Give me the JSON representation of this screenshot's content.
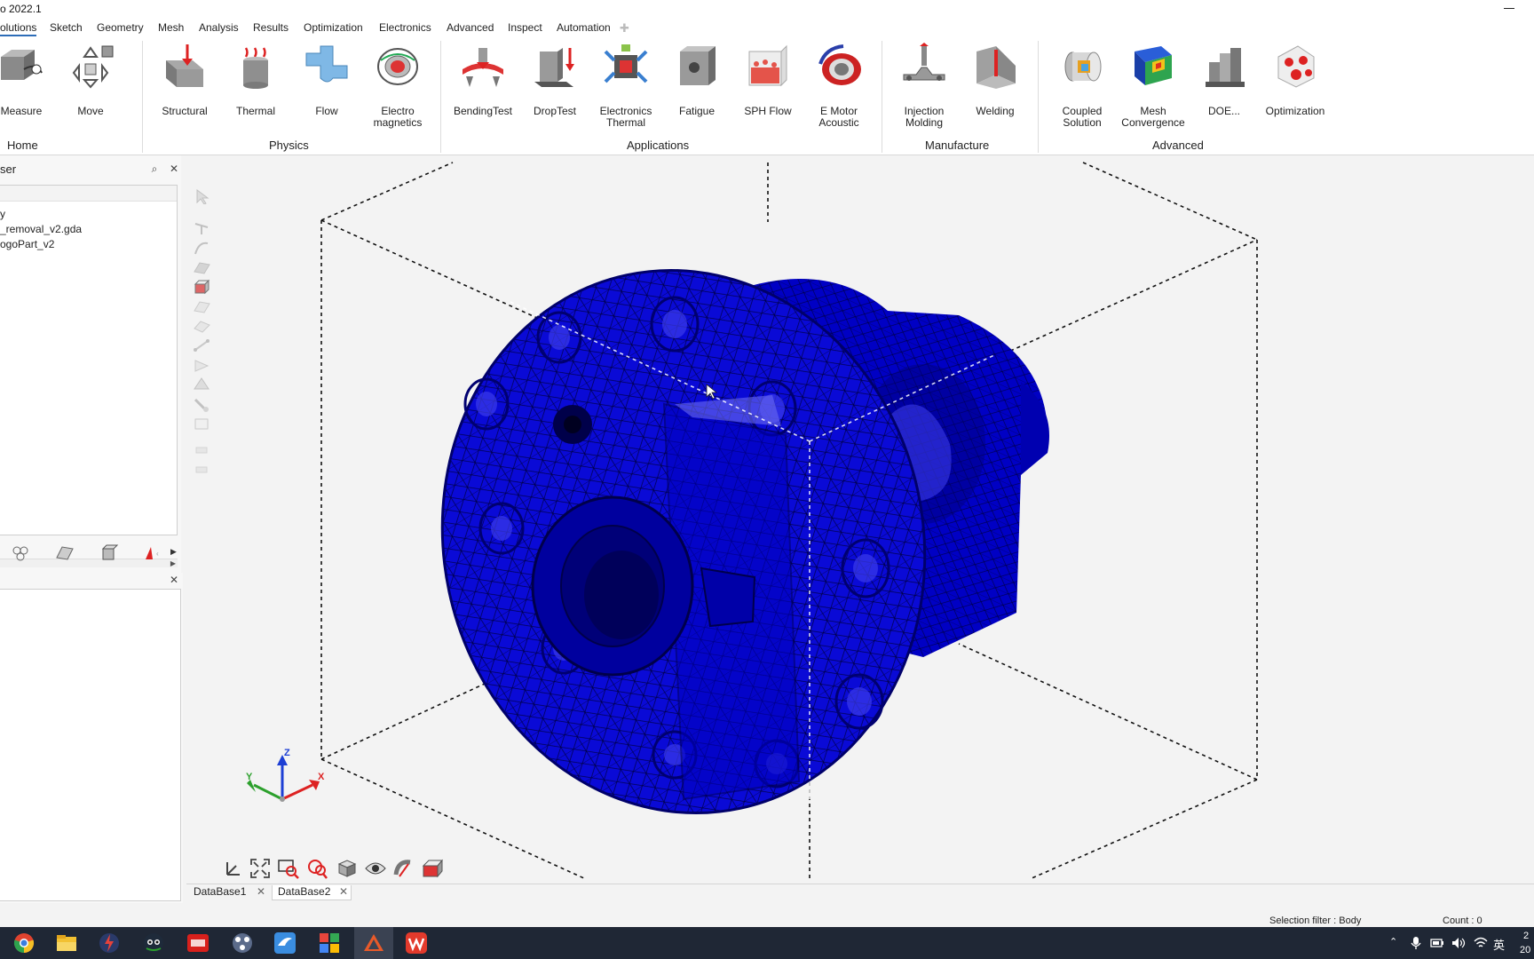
{
  "window": {
    "title": "o 2022.1"
  },
  "menu": [
    "olutions",
    "Sketch",
    "Geometry",
    "Mesh",
    "Analysis",
    "Results",
    "Optimization",
    "Electronics",
    "Advanced",
    "Inspect",
    "Automation"
  ],
  "ribbon": {
    "home": {
      "label": "Home",
      "buttons": [
        "Measure",
        "Move"
      ]
    },
    "physics": {
      "label": "Physics",
      "buttons": [
        "Structural",
        "Thermal",
        "Flow",
        "Electro\nmagnetics"
      ]
    },
    "applications": {
      "label": "Applications",
      "buttons": [
        "BendingTest",
        "DropTest",
        "Electronics\nThermal",
        "Fatigue",
        "SPH Flow",
        "E Motor\nAcoustic"
      ]
    },
    "manufacture": {
      "label": "Manufacture",
      "buttons": [
        "Injection\nMolding",
        "Welding"
      ]
    },
    "advanced": {
      "label": "Advanced",
      "buttons": [
        "Coupled\nSolution",
        "Mesh\nConvergence",
        "DOE...",
        "Optimization"
      ]
    }
  },
  "browser": {
    "title": "ser",
    "tree": [
      "y",
      "_removal_v2.gda",
      "ogoPart_v2"
    ]
  },
  "axes": {
    "x": "X",
    "y": "Y",
    "z": "Z"
  },
  "db_tabs": [
    "DataBase1",
    "DataBase2"
  ],
  "status": {
    "selection_filter": "Selection filter : Body",
    "count": "Count : 0"
  },
  "tray": {
    "ime": "英",
    "clock_top": "2",
    "clock_bottom": "20"
  },
  "colors": {
    "mesh_body": "#0a0ad6",
    "accent": "#2d6db8",
    "taskbar": "#1f2735"
  }
}
